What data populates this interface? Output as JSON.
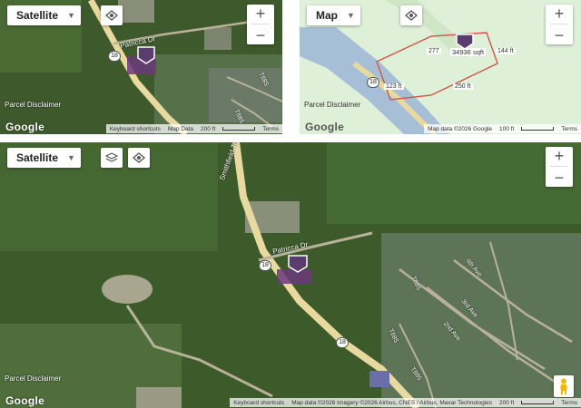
{
  "panels": {
    "top_left": {
      "map_type": "Satellite",
      "road_labels": [
        "Patricca Dr",
        "T885",
        "T885"
      ],
      "route_shield": "18",
      "parcel_disclaimer": "Parcel Disclaimer",
      "google_logo": "Google",
      "attribution": {
        "shortcuts": "Keyboard shortcuts",
        "map_data": "Map Data",
        "scale": "200 ft",
        "terms": "Terms"
      },
      "zoom_in": "+",
      "zoom_out": "−"
    },
    "top_right": {
      "map_type": "Map",
      "route_shield": "18",
      "dimensions": {
        "top_left": "277",
        "area": "34936 sqft",
        "top_right": "144 ft",
        "left": "123 ft",
        "bottom": "250 ft"
      },
      "parcel_disclaimer": "Parcel Disclaimer",
      "google_logo": "Google",
      "attribution": {
        "map_data": "Map data ©2026 Google",
        "scale": "100 ft",
        "terms": "Terms"
      },
      "zoom_in": "+",
      "zoom_out": "−"
    },
    "bottom": {
      "map_type": "Satellite",
      "road_labels": [
        "Smithfield Township State Rd",
        "Patricca Dr",
        "T885",
        "T885",
        "T885",
        "4th Ave",
        "3rd Ave",
        "2nd Ave"
      ],
      "route_shields": [
        "18",
        "18"
      ],
      "parcel_disclaimer": "Parcel Disclaimer",
      "google_logo": "Google",
      "attribution": {
        "shortcuts": "Keyboard shortcuts",
        "map_data": "Map data ©2026 Imagery ©2026 Airbus, CNES / Airbus, Maxar Technologies",
        "scale": "200 ft",
        "terms": "Terms"
      },
      "zoom_in": "+",
      "zoom_out": "−"
    }
  },
  "icons": {
    "map_type_caret": "caret-down-icon",
    "locate": "locate-icon",
    "layers": "layers-icon",
    "marker": "parcel-marker-icon",
    "street_view": "pegman-icon"
  },
  "colors": {
    "parcel_fill": "#6b3a7a",
    "marker": "#5b3c6e",
    "road": "#e8d9a0",
    "dimension_outline": "#d0574a",
    "water": "#a6bfd6",
    "land": "#dff0d8"
  }
}
